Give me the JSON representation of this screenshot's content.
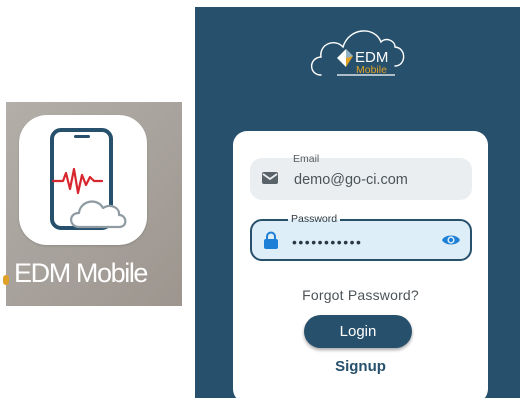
{
  "app_icon": {
    "name": "EDM Mobile",
    "icon": "phone-heartbeat-cloud-icon"
  },
  "login_screen": {
    "logo": {
      "brand_main": "EDM",
      "brand_sub": "Mobile",
      "icon": "cloud-logo-icon"
    },
    "email": {
      "label": "Email",
      "value": "demo@go-ci.com",
      "icon": "envelope-icon"
    },
    "password": {
      "label": "Password",
      "value": "•••••••••••",
      "icon": "lock-icon",
      "toggle_icon": "eye-icon"
    },
    "forgot_password": "Forgot Password?",
    "login_button": "Login",
    "signup_link": "Signup"
  },
  "colors": {
    "brand_navy": "#26506b",
    "card_white": "#ffffff",
    "heartbeat_red": "#d8262e",
    "logo_gold": "#e0a126"
  }
}
